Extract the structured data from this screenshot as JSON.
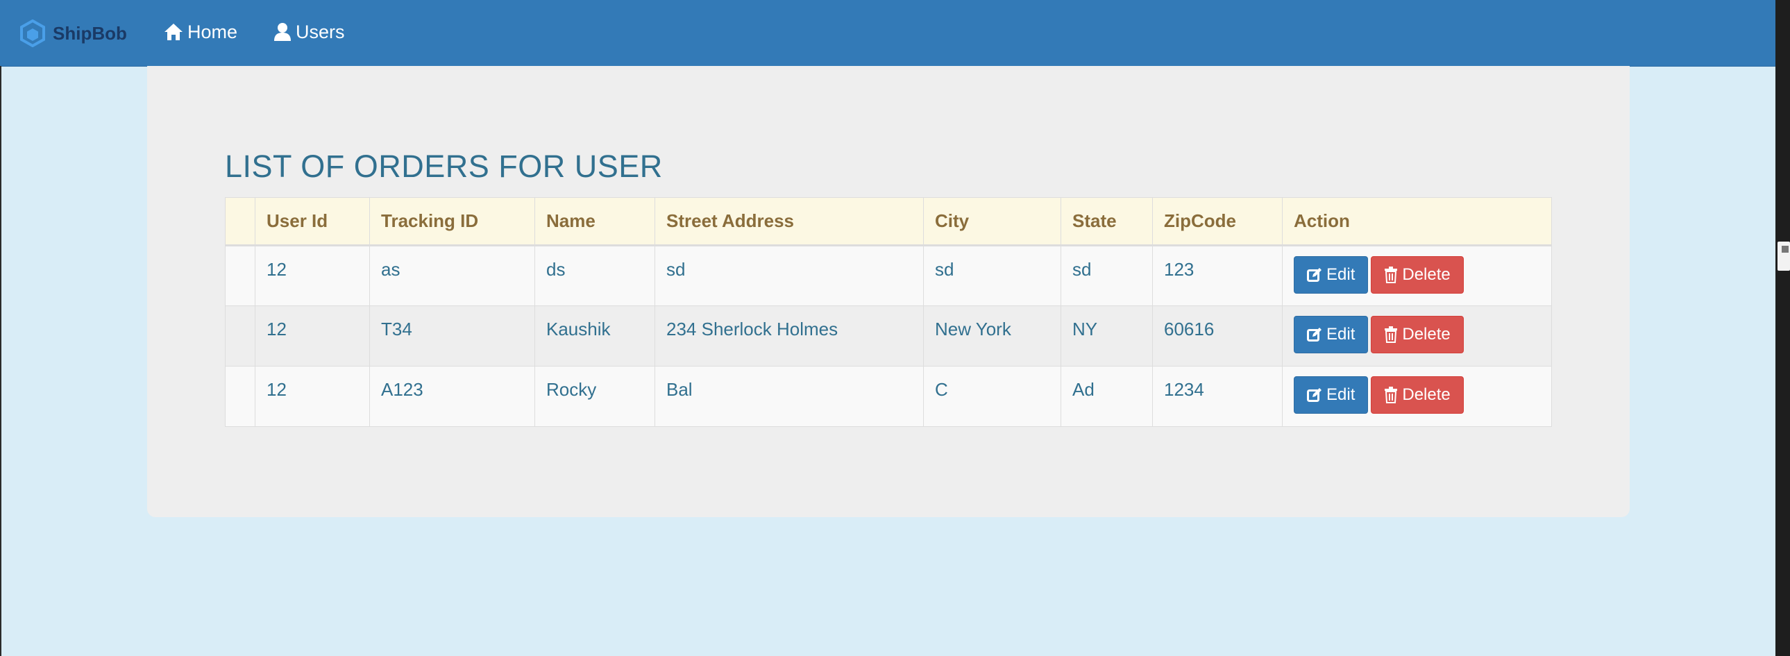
{
  "navbar": {
    "brand": "ShipBob",
    "home_label": "Home",
    "users_label": "Users"
  },
  "page": {
    "heading": "LIST OF ORDERS FOR USER"
  },
  "table": {
    "headers": [
      "",
      "User Id",
      "Tracking ID",
      "Name",
      "Street Address",
      "City",
      "State",
      "ZipCode",
      "Action"
    ],
    "rows": [
      {
        "user_id": "12",
        "tracking_id": "as",
        "name": "ds",
        "street": "sd",
        "city": "sd",
        "state": "sd",
        "zip": "123"
      },
      {
        "user_id": "12",
        "tracking_id": "T34",
        "name": "Kaushik",
        "street": "234 Sherlock Holmes",
        "city": "New York",
        "state": "NY",
        "zip": "60616"
      },
      {
        "user_id": "12",
        "tracking_id": "A123",
        "name": "Rocky",
        "street": "Bal",
        "city": "C",
        "state": "Ad",
        "zip": "1234"
      }
    ],
    "edit_label": "Edit",
    "delete_label": "Delete"
  },
  "colors": {
    "navbar": "#337ab7",
    "page_background": "#d9edf7",
    "heading": "#31708f",
    "header_row": "#fcf8e3",
    "header_text": "#8a6d3b",
    "edit_button": "#337ab7",
    "delete_button": "#d9534f"
  },
  "icons": {
    "brand": "shipbob-logo-icon",
    "home": "home-icon",
    "users": "user-icon",
    "edit": "edit-icon",
    "delete": "trash-icon"
  }
}
